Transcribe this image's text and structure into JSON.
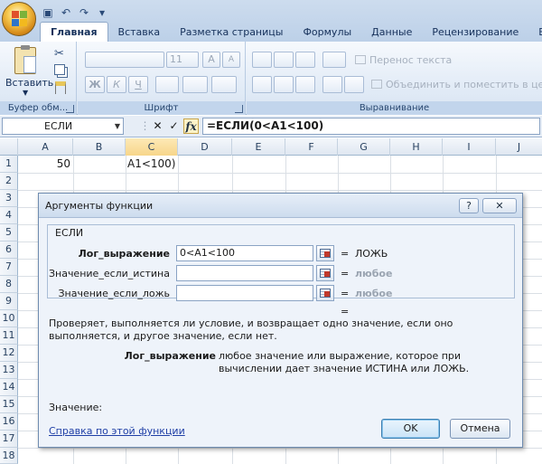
{
  "ribbon": {
    "tabs": [
      "Главная",
      "Вставка",
      "Разметка страницы",
      "Формулы",
      "Данные",
      "Рецензирование",
      "Вид"
    ],
    "active_tab": "Главная",
    "paste_label": "Вставить",
    "groups": {
      "clipboard": "Буфер обм...",
      "font": "Шрифт",
      "alignment": "Выравнивание"
    },
    "font_size": "11",
    "bold": "Ж",
    "italic": "К",
    "underline": "Ч",
    "wrap_text": "Перенос текста",
    "merge_center": "Объединить и поместить в центре"
  },
  "formula_bar": {
    "name_box": "ЕСЛИ",
    "cancel": "✕",
    "enter": "✓",
    "fx": "fx",
    "formula": "=ЕСЛИ(0<A1<100)"
  },
  "sheet": {
    "columns": [
      "A",
      "B",
      "C",
      "D",
      "E",
      "F",
      "G",
      "H",
      "I",
      "J"
    ],
    "rows": [
      "1",
      "2",
      "3",
      "4",
      "5",
      "6",
      "7",
      "8",
      "9",
      "10",
      "11",
      "12",
      "13",
      "14",
      "15",
      "16",
      "17",
      "18"
    ],
    "a1": "50",
    "c1": "A1<100)"
  },
  "dialog": {
    "title": "Аргументы функции",
    "help_btn": "?",
    "close_btn": "✕",
    "function_name": "ЕСЛИ",
    "args": [
      {
        "label": "Лог_выражение",
        "value": "0<A1<100",
        "result": "ЛОЖЬ"
      },
      {
        "label": "Значение_если_истина",
        "value": "",
        "result": "любое"
      },
      {
        "label": "Значение_если_ложь",
        "value": "",
        "result": "любое"
      }
    ],
    "eq": "=",
    "description": "Проверяет, выполняется ли условие, и возвращает одно значение, если оно выполняется, и другое значение, если нет.",
    "arg_help_name": "Лог_выражение",
    "arg_help_text": "любое значение или выражение, которое при вычислении дает значение ИСТИНА или ЛОЖЬ.",
    "value_label": "Значение:",
    "help_link": "Справка по этой функции",
    "ok": "OK",
    "cancel": "Отмена"
  }
}
